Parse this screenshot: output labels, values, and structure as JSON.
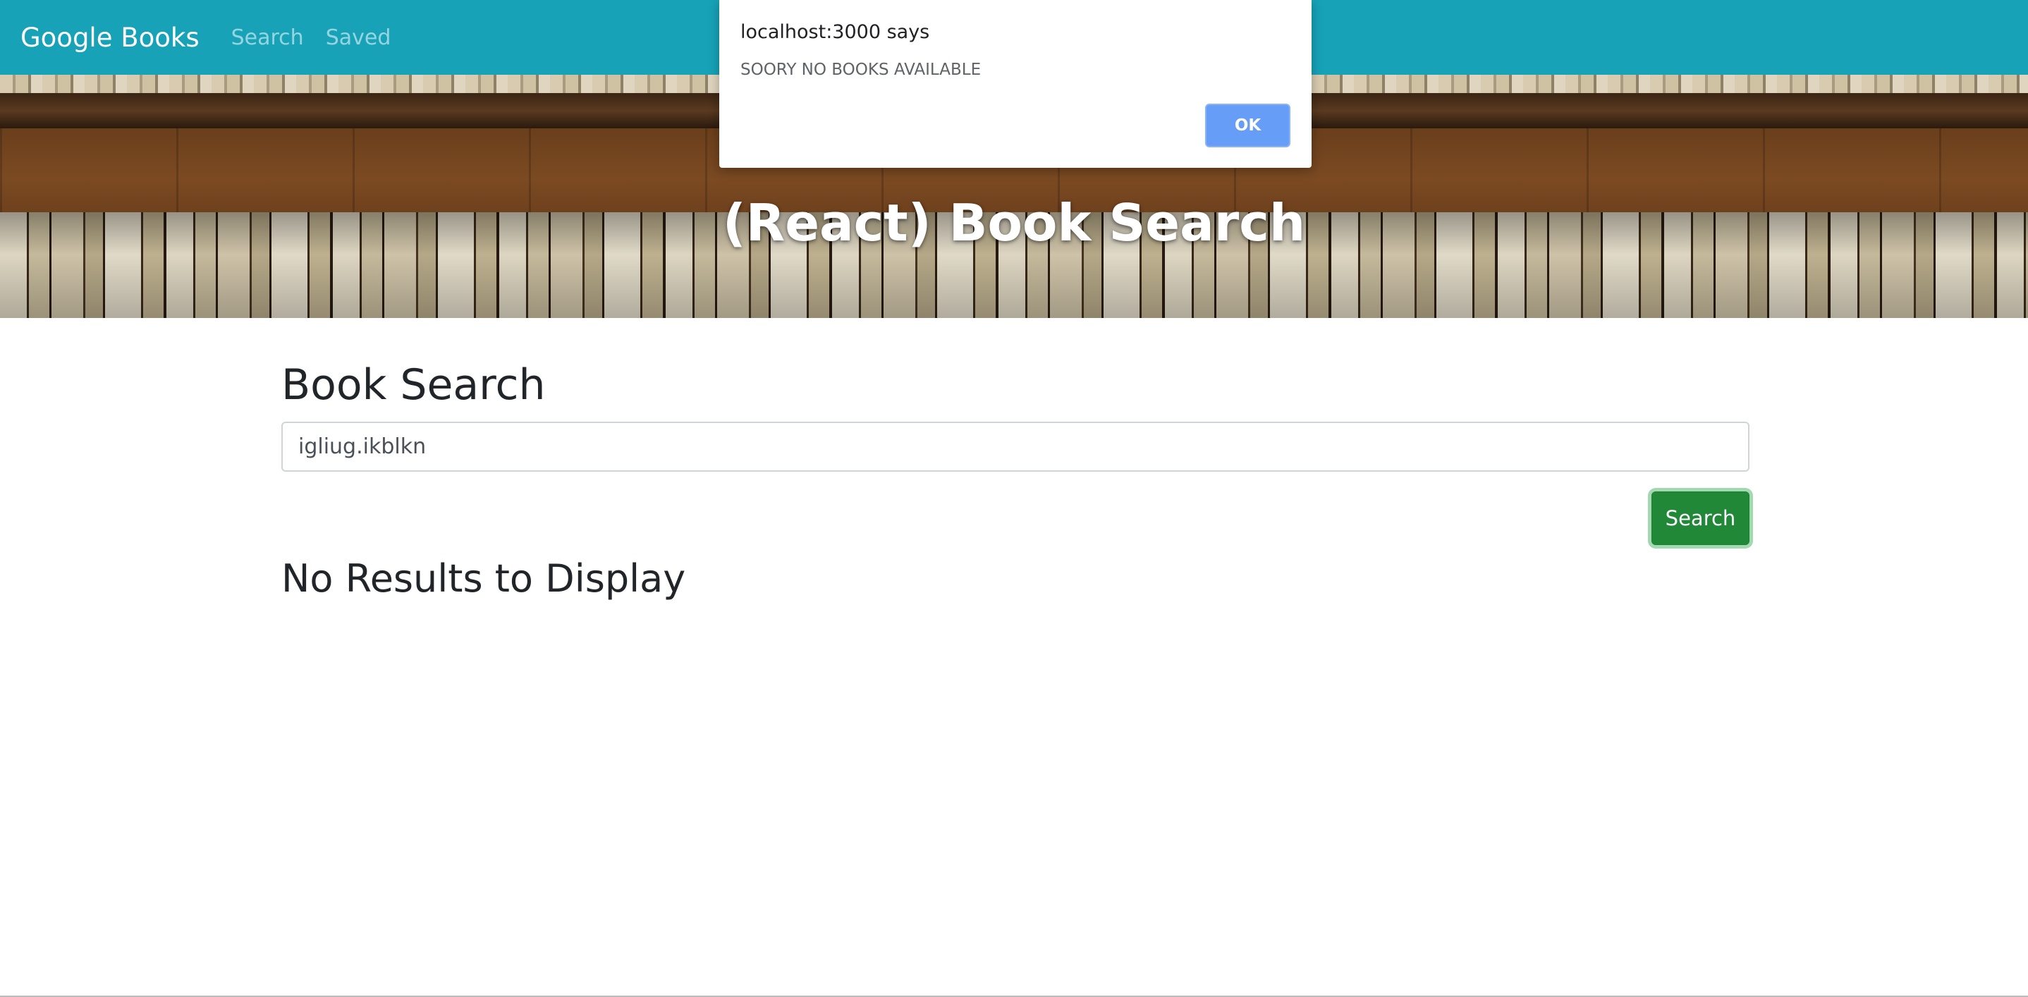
{
  "navbar": {
    "brand": "Google Books",
    "links": [
      "Search",
      "Saved"
    ],
    "color": "#17a2b8"
  },
  "hero": {
    "title": "(React) Book Search"
  },
  "main": {
    "section_title": "Book Search",
    "search_value": "igliug.ikblkn",
    "search_button": "Search",
    "no_results": "No Results to Display"
  },
  "dialog": {
    "title": "localhost:3000 says",
    "message": "SOORY NO BOOKS AVAILABLE",
    "ok_label": "OK",
    "ok_color": "#669df6"
  }
}
